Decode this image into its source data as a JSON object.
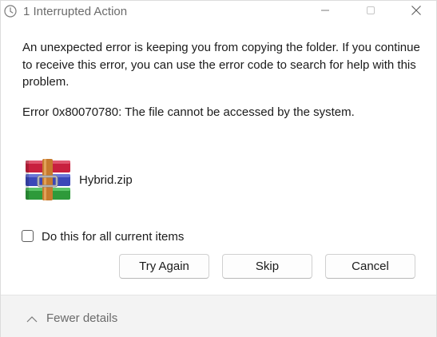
{
  "window": {
    "title": "1 Interrupted Action",
    "icons": {
      "title": "clock-icon",
      "minimize": "minimize-icon",
      "maximize": "maximize-icon",
      "close": "close-icon"
    }
  },
  "message": {
    "body": "An unexpected error is keeping you from copying the folder. If you continue to receive this error, you can use the error code to search for help with this problem.",
    "error": "Error 0x80070780: The file cannot be accessed by the system."
  },
  "file": {
    "name": "Hybrid.zip",
    "icon": "winrar-archive-icon"
  },
  "checkbox": {
    "label": "Do this for all current items",
    "checked": false
  },
  "buttons": {
    "try_again": "Try Again",
    "skip": "Skip",
    "cancel": "Cancel"
  },
  "footer": {
    "toggle_label": "Fewer details",
    "icon": "chevron-up-icon"
  },
  "colors": {
    "window_bg": "#ffffff",
    "footer_bg": "#f3f3f3",
    "title_text": "#6b6b6b",
    "body_text": "#1b1b1b"
  }
}
